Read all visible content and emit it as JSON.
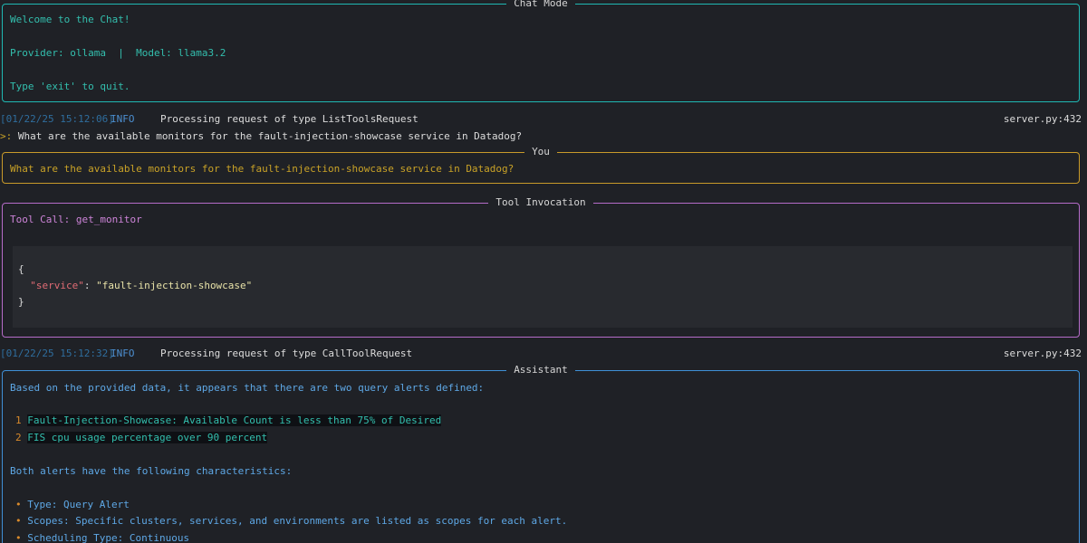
{
  "chat_mode": {
    "title": "Chat Mode",
    "welcome": "Welcome to the Chat!",
    "provider_line": "Provider: ollama  |  Model: llama3.2",
    "quit_hint": "Type 'exit' to quit."
  },
  "log1": {
    "timestamp": "[01/22/25 15:12:06]",
    "level": "INFO",
    "message": "Processing request of type ListToolsRequest",
    "source": "server.py:432"
  },
  "prompt": {
    "marker": ">:",
    "text": " What are the available monitors for the fault-injection-showcase service in Datadog?"
  },
  "you_panel": {
    "title": "You",
    "text": "What are the available monitors for the fault-injection-showcase service in Datadog?"
  },
  "tool_panel": {
    "title": "Tool Invocation",
    "tool_call": "Tool Call: get_monitor",
    "code_open": "{",
    "code_key": "\"service\"",
    "code_sep": ": ",
    "code_value": "\"fault-injection-showcase\"",
    "code_close": "}"
  },
  "log2": {
    "timestamp": "[01/22/25 15:12:32]",
    "level": "INFO",
    "message": "Processing request of type CallToolRequest",
    "source": "server.py:432"
  },
  "assistant_panel": {
    "title": "Assistant",
    "intro": "Based on the provided data, it appears that there are two query alerts defined:",
    "numbered": [
      {
        "num": "1",
        "text": "Fault-Injection-Showcase: Available Count is less than 75% of Desired"
      },
      {
        "num": "2",
        "text": "FIS cpu usage percentage over 90 percent"
      }
    ],
    "characteristics": "Both alerts have the following characteristics:",
    "bullets": [
      {
        "marker": "•",
        "text": "Type: Query Alert"
      },
      {
        "marker": "•",
        "text": "Scopes: Specific clusters, services, and environments are listed as scopes for each alert."
      },
      {
        "marker": "•",
        "text": "Scheduling Type: Continuous"
      }
    ]
  }
}
